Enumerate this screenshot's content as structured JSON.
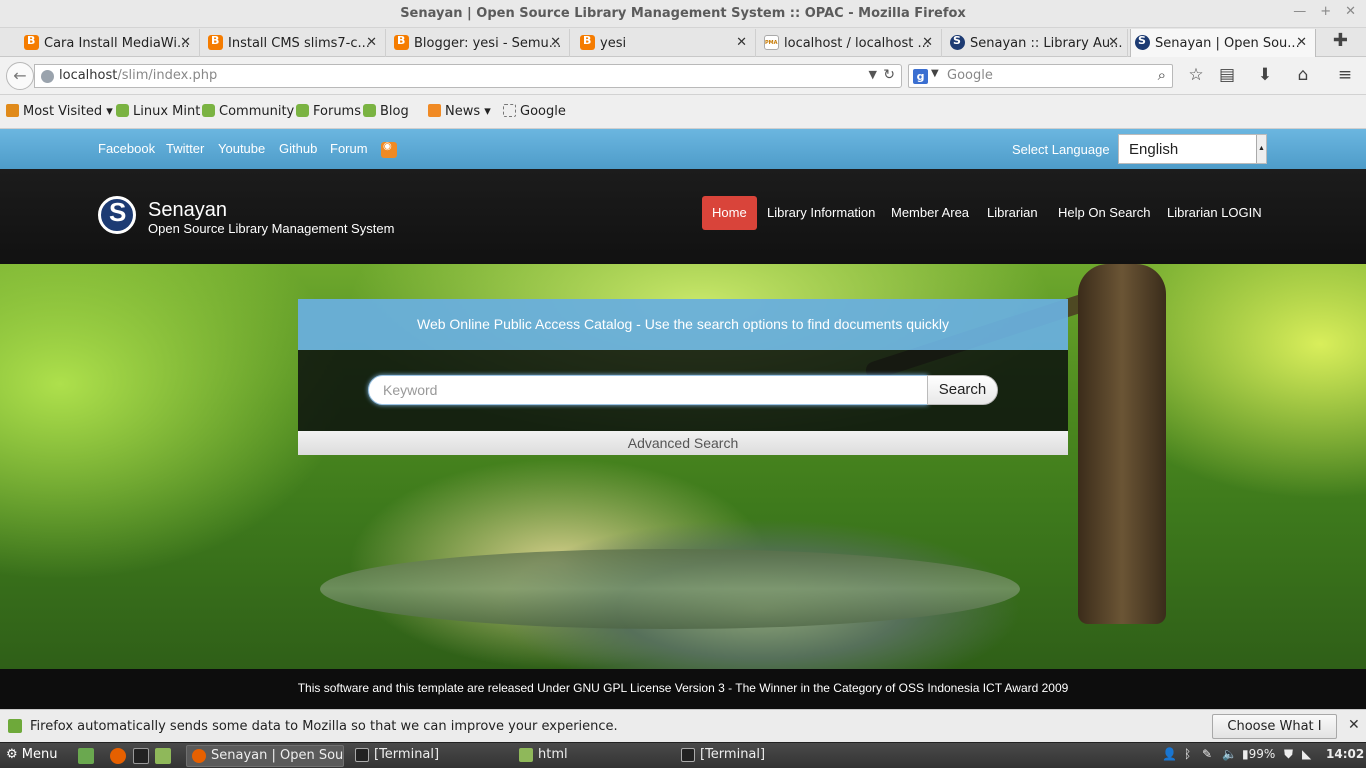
{
  "browser": {
    "window_title": "Senayan | Open Source Library Management System :: OPAC - Mozilla Firefox",
    "tabs": [
      {
        "label": "Cara Install MediaWi...",
        "icon": "blogger-icon"
      },
      {
        "label": "Install CMS slims7-c...",
        "icon": "blogger-icon"
      },
      {
        "label": "Blogger: yesi - Semu...",
        "icon": "blogger-icon"
      },
      {
        "label": "yesi",
        "icon": "blogger-icon"
      },
      {
        "label": "localhost / localhost ...",
        "icon": "phpmyadmin-icon"
      },
      {
        "label": "Senayan :: Library Au...",
        "icon": "senayan-icon"
      },
      {
        "label": "Senayan | Open Sou...",
        "icon": "senayan-icon",
        "active": true
      }
    ],
    "url_host": "localhost",
    "url_path": "/slim/index.php",
    "search_engine_placeholder": "Google",
    "bookmarks": [
      "Most Visited",
      "Linux Mint",
      "Community",
      "Forums",
      "Blog",
      "News",
      "Google"
    ]
  },
  "site": {
    "social_links": [
      "Facebook",
      "Twitter",
      "Youtube",
      "Github",
      "Forum"
    ],
    "language_label": "Select Language",
    "language_value": "English",
    "brand_name": "Senayan",
    "tagline": "Open Source Library Management System",
    "nav": [
      "Home",
      "Library Information",
      "Member Area",
      "Librarian",
      "Help On Search",
      "Librarian LOGIN"
    ],
    "catalog_heading": "Web Online Public Access Catalog - Use the search options to find documents quickly",
    "keyword_placeholder": "Keyword",
    "search_button": "Search",
    "advanced_search": "Advanced Search",
    "footer_text": "This software and this template are released Under GNU GPL License Version 3 - The Winner in the Category of OSS Indonesia ICT Award 2009"
  },
  "notification": {
    "text": "Firefox automatically sends some data to Mozilla so that we can improve your experience.",
    "button": "Choose What I Share"
  },
  "taskbar": {
    "menu_label": "Menu",
    "windows": [
      "Senayan | Open Sou...",
      "[Terminal]",
      "html",
      "[Terminal]"
    ],
    "battery": "99%",
    "clock": "14:02"
  },
  "colors": {
    "topbar_blue": "#5aa8d6",
    "home_active": "#d9443a",
    "header_dark": "#151515"
  }
}
